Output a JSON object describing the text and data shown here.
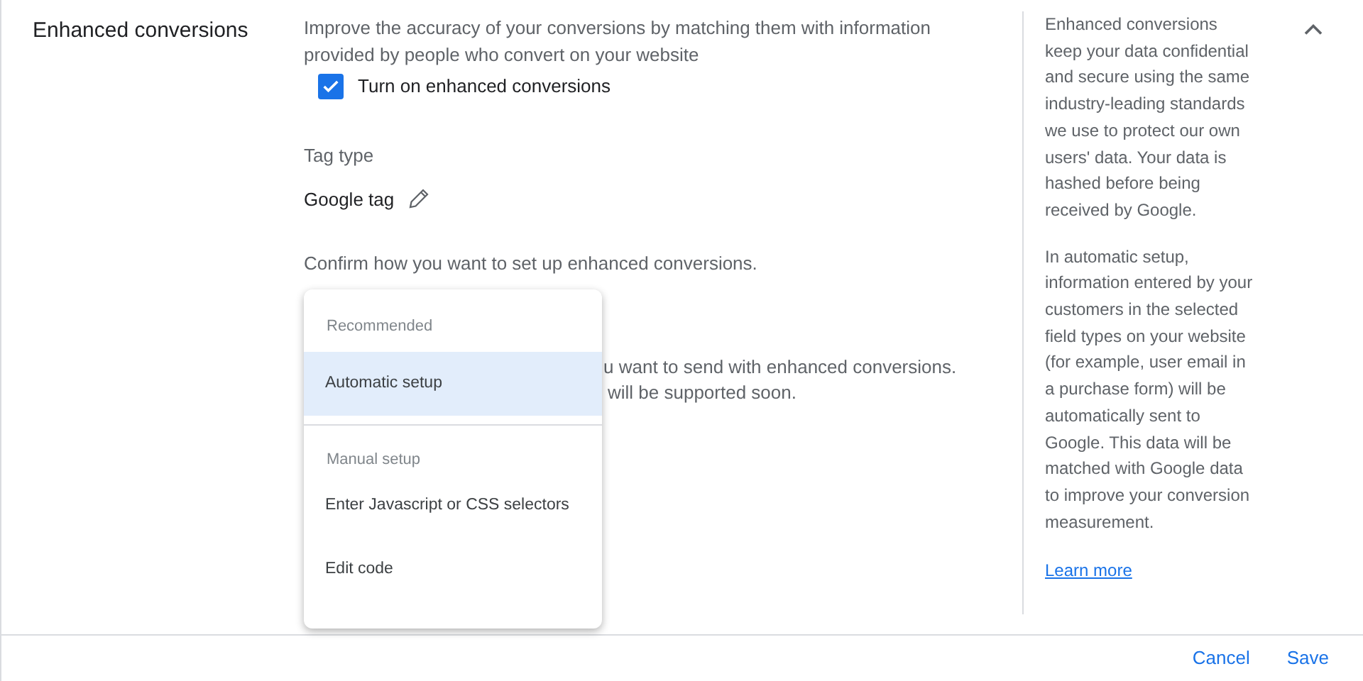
{
  "section_title": "Enhanced conversions",
  "description": "Improve the accuracy of your conversions by matching them with information provided by people who convert on your website",
  "enable_checkbox": {
    "label": "Turn on enhanced conversions",
    "checked": true
  },
  "tag_type": {
    "label": "Tag type",
    "value": "Google tag"
  },
  "setup_prompt": "Confirm how you want to set up enhanced conversions.",
  "covered_lines": [
    "u want to send with enhanced conversions.",
    "will be supported soon."
  ],
  "setup_menu": {
    "sections": [
      {
        "header": "Recommended",
        "options": [
          {
            "label": "Automatic setup",
            "selected": true
          }
        ]
      },
      {
        "header": "Manual setup",
        "options": [
          {
            "label": "Enter Javascript or CSS selectors",
            "selected": false
          },
          {
            "label": "Edit code",
            "selected": false
          }
        ]
      }
    ]
  },
  "help": {
    "paragraphs": [
      "Enhanced conversions keep your data confidential and secure using the same industry-leading standards we use to protect our own users' data. Your data is hashed before being received by Google.",
      "In automatic setup, information entered by your customers in the selected field types on your website (for example, user email in a purchase form) will be automatically sent to Google. This data will be matched with Google data to improve your conversion measurement."
    ],
    "link": "Learn more"
  },
  "expanded": true,
  "footer": {
    "buttons": [
      "Cancel",
      "Save"
    ]
  }
}
